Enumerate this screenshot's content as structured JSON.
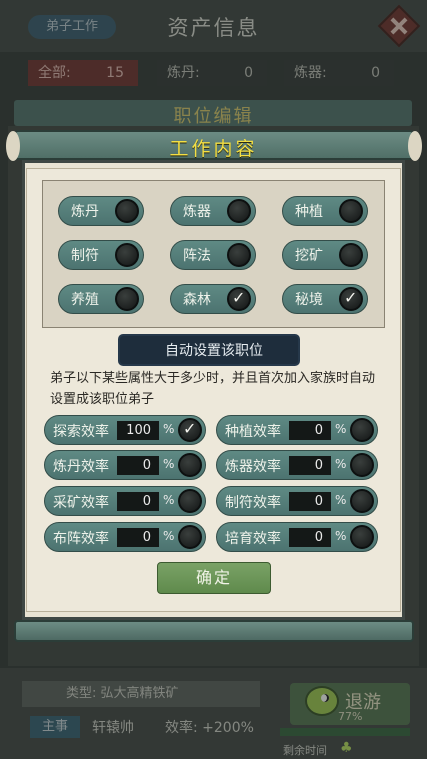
{
  "background": {
    "tab_label": "弟子工作",
    "title": "资产信息",
    "stats": [
      {
        "label": "全部:",
        "value": "15"
      },
      {
        "label": "炼丹:",
        "value": "0"
      },
      {
        "label": "炼器:",
        "value": "0"
      }
    ],
    "scroll_title": "职位编辑",
    "bottom": {
      "type_text": "类型: 弘大高精铁矿",
      "tag": "主事",
      "level": "轩辕帅",
      "efficiency": "效率: +200%",
      "right_button": "退游",
      "percent": "77%",
      "bar_caption": "剩余时间"
    }
  },
  "modal": {
    "title": "工作内容",
    "jobs": [
      {
        "label": "炼丹",
        "checked": false
      },
      {
        "label": "炼器",
        "checked": false
      },
      {
        "label": "种植",
        "checked": false
      },
      {
        "label": "制符",
        "checked": false
      },
      {
        "label": "阵法",
        "checked": false
      },
      {
        "label": "挖矿",
        "checked": false
      },
      {
        "label": "养殖",
        "checked": false
      },
      {
        "label": "森林",
        "checked": true
      },
      {
        "label": "秘境",
        "checked": true
      }
    ],
    "auto_title": "自动设置该职位",
    "description": "弟子以下某些属性大于多少时，并且首次加入家族时自动设置成该职位弟子",
    "attributes": [
      {
        "label": "探索效率",
        "value": "100",
        "unit": "%",
        "checked": true
      },
      {
        "label": "种植效率",
        "value": "0",
        "unit": "%",
        "checked": false
      },
      {
        "label": "炼丹效率",
        "value": "0",
        "unit": "%",
        "checked": false
      },
      {
        "label": "炼器效率",
        "value": "0",
        "unit": "%",
        "checked": false
      },
      {
        "label": "采矿效率",
        "value": "0",
        "unit": "%",
        "checked": false
      },
      {
        "label": "制符效率",
        "value": "0",
        "unit": "%",
        "checked": false
      },
      {
        "label": "布阵效率",
        "value": "0",
        "unit": "%",
        "checked": false
      },
      {
        "label": "培育效率",
        "value": "0",
        "unit": "%",
        "checked": false
      }
    ],
    "confirm_label": "确定"
  }
}
